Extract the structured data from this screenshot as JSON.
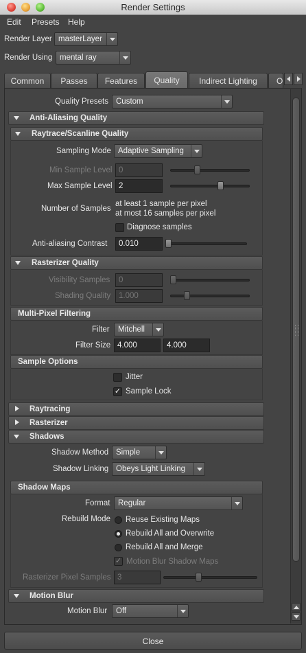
{
  "window": {
    "title": "Render Settings"
  },
  "menu": [
    "Edit",
    "Presets",
    "Help"
  ],
  "render_layer": {
    "label": "Render Layer",
    "value": "masterLayer"
  },
  "render_using": {
    "label": "Render Using",
    "value": "mental ray"
  },
  "tabs": [
    "Common",
    "Passes",
    "Features",
    "Quality",
    "Indirect Lighting",
    "O"
  ],
  "active_tab": "Quality",
  "quality_presets": {
    "label": "Quality Presets",
    "value": "Custom"
  },
  "sections": {
    "anti_aliasing": "Anti-Aliasing Quality",
    "raytrace": "Raytrace/Scanline Quality",
    "rasterizer_quality": "Rasterizer Quality",
    "multipixel": "Multi-Pixel Filtering",
    "sample_options": "Sample Options",
    "raytracing": "Raytracing",
    "rasterizer": "Rasterizer",
    "shadows": "Shadows",
    "shadow_maps": "Shadow Maps",
    "motion_blur": "Motion Blur"
  },
  "sampling_mode": {
    "label": "Sampling Mode",
    "value": "Adaptive Sampling"
  },
  "min_sample_level": {
    "label": "Min Sample Level",
    "value": "0",
    "slider_fraction": 0.33
  },
  "max_sample_level": {
    "label": "Max Sample Level",
    "value": "2",
    "slider_fraction": 0.66
  },
  "number_of_samples": {
    "label": "Number of Samples",
    "line1": "at least 1 sample per pixel",
    "line2": "at most 16 samples per pixel"
  },
  "diagnose_samples": {
    "label": "Diagnose samples",
    "checked": false
  },
  "aa_contrast": {
    "label": "Anti-aliasing Contrast",
    "value": "0.010",
    "slider_fraction": 0.01
  },
  "visibility_samples": {
    "label": "Visibility Samples",
    "value": "0",
    "slider_fraction": 0.0
  },
  "shading_quality": {
    "label": "Shading Quality",
    "value": "1.000",
    "slider_fraction": 0.2
  },
  "filter": {
    "label": "Filter",
    "value": "Mitchell"
  },
  "filter_size": {
    "label": "Filter Size",
    "x": "4.000",
    "y": "4.000"
  },
  "jitter": {
    "label": "Jitter",
    "checked": false
  },
  "sample_lock": {
    "label": "Sample Lock",
    "checked": true
  },
  "shadow_method": {
    "label": "Shadow Method",
    "value": "Simple"
  },
  "shadow_linking": {
    "label": "Shadow Linking",
    "value": "Obeys Light Linking"
  },
  "format": {
    "label": "Format",
    "value": "Regular"
  },
  "rebuild_mode": {
    "label": "Rebuild Mode",
    "options": [
      "Reuse Existing Maps",
      "Rebuild All and Overwrite",
      "Rebuild All and Merge"
    ],
    "selected": "Rebuild All and Overwrite"
  },
  "motion_blur_shadow_maps": {
    "label": "Motion Blur Shadow Maps",
    "checked": true
  },
  "rasterizer_pixel_samples": {
    "label": "Rasterizer Pixel Samples",
    "value": "3",
    "slider_fraction": 0.25
  },
  "motion_blur": {
    "label": "Motion Blur",
    "value": "Off"
  },
  "close_label": "Close",
  "icons": {
    "check": "✓"
  }
}
